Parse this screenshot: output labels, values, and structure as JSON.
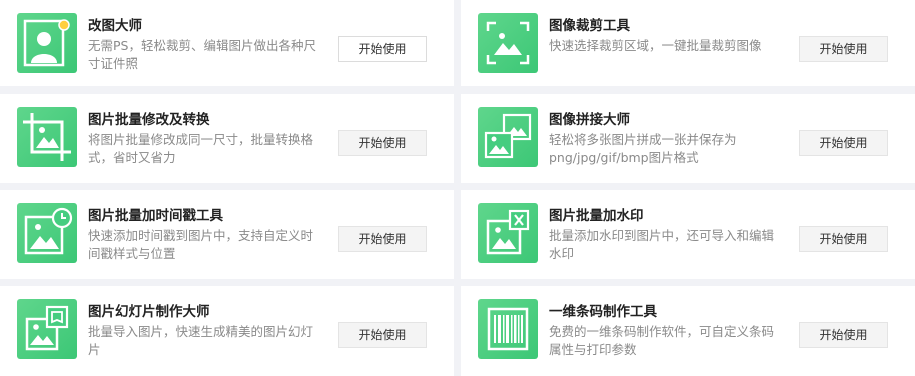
{
  "tools": [
    {
      "title": "改图大师",
      "desc": "无需PS，轻松裁剪、编辑图片做出各种尺寸证件照",
      "button": "开始使用",
      "icon": "id-photo-person-icon"
    },
    {
      "title": "图像裁剪工具",
      "desc": "快速选择裁剪区域，一键批量裁剪图像",
      "button": "开始使用",
      "icon": "crop-frame-image-icon"
    },
    {
      "title": "图片批量修改及转换",
      "desc": "将图片批量修改成同一尺寸，批量转换格式，省时又省力",
      "button": "开始使用",
      "icon": "crop-resize-icon"
    },
    {
      "title": "图像拼接大师",
      "desc": "轻松将多张图片拼成一张并保存为png/jpg/gif/bmp图片格式",
      "button": "开始使用",
      "icon": "stacked-images-icon"
    },
    {
      "title": "图片批量加时间戳工具",
      "desc": "快速添加时间戳到图片中，支持自定义时间戳样式与位置",
      "button": "开始使用",
      "icon": "image-clock-icon"
    },
    {
      "title": "图片批量加水印",
      "desc": "批量添加水印到图片中，还可导入和编辑水印",
      "button": "开始使用",
      "icon": "image-watermark-icon"
    },
    {
      "title": "图片幻灯片制作大师",
      "desc": "批量导入图片，快速生成精美的图片幻灯片",
      "button": "开始使用",
      "icon": "image-slideshow-icon"
    },
    {
      "title": "一维条码制作工具",
      "desc": "免费的一维条码制作软件，可自定义条码属性与打印参数",
      "button": "开始使用",
      "icon": "barcode-icon"
    }
  ],
  "colors": {
    "accent_green": "#3cc776",
    "page_background": "#f1f2f6"
  }
}
